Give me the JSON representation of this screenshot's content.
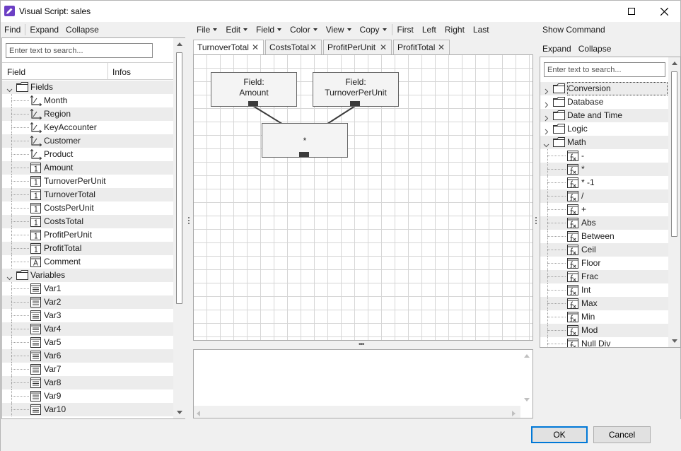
{
  "window": {
    "title": "Visual Script: sales",
    "icon": "pencil-icon"
  },
  "left": {
    "toolbar": [
      "Find",
      "Expand",
      "Collapse"
    ],
    "search_placeholder": "Enter text to search...",
    "columns": [
      "Field",
      "Infos"
    ],
    "tree": [
      {
        "label": "Fields",
        "icon": "folder-icon",
        "expanded": true,
        "level": 0
      },
      {
        "label": "Month",
        "icon": "dimension-icon",
        "level": 1
      },
      {
        "label": "Region",
        "icon": "dimension-icon",
        "level": 1
      },
      {
        "label": "KeyAccounter",
        "icon": "dimension-icon",
        "level": 1
      },
      {
        "label": "Customer",
        "icon": "dimension-icon",
        "level": 1
      },
      {
        "label": "Product",
        "icon": "dimension-icon",
        "level": 1
      },
      {
        "label": "Amount",
        "icon": "number-icon",
        "level": 1
      },
      {
        "label": "TurnoverPerUnit",
        "icon": "number-icon",
        "level": 1
      },
      {
        "label": "TurnoverTotal",
        "icon": "number-icon",
        "level": 1
      },
      {
        "label": "CostsPerUnit",
        "icon": "number-icon",
        "level": 1
      },
      {
        "label": "CostsTotal",
        "icon": "number-icon",
        "level": 1
      },
      {
        "label": "ProfitPerUnit",
        "icon": "number-icon",
        "level": 1
      },
      {
        "label": "ProfitTotal",
        "icon": "number-icon",
        "level": 1
      },
      {
        "label": "Comment",
        "icon": "text-icon",
        "level": 1
      },
      {
        "label": "Variables",
        "icon": "folder-icon",
        "expanded": true,
        "level": 0
      },
      {
        "label": "Var1",
        "icon": "variable-icon",
        "level": 1
      },
      {
        "label": "Var2",
        "icon": "variable-icon",
        "level": 1
      },
      {
        "label": "Var3",
        "icon": "variable-icon",
        "level": 1
      },
      {
        "label": "Var4",
        "icon": "variable-icon",
        "level": 1
      },
      {
        "label": "Var5",
        "icon": "variable-icon",
        "level": 1
      },
      {
        "label": "Var6",
        "icon": "variable-icon",
        "level": 1
      },
      {
        "label": "Var7",
        "icon": "variable-icon",
        "level": 1
      },
      {
        "label": "Var8",
        "icon": "variable-icon",
        "level": 1
      },
      {
        "label": "Var9",
        "icon": "variable-icon",
        "level": 1
      },
      {
        "label": "Var10",
        "icon": "variable-icon",
        "level": 1
      }
    ]
  },
  "center": {
    "menu": [
      {
        "label": "File",
        "dropdown": true
      },
      {
        "label": "Edit",
        "dropdown": true
      },
      {
        "label": "Field",
        "dropdown": true
      },
      {
        "label": "Color",
        "dropdown": true
      },
      {
        "label": "View",
        "dropdown": true
      },
      {
        "label": "Copy",
        "dropdown": true
      },
      {
        "label": "First",
        "dropdown": false
      },
      {
        "label": "Left",
        "dropdown": false
      },
      {
        "label": "Right",
        "dropdown": false
      },
      {
        "label": "Last",
        "dropdown": false
      }
    ],
    "tabs": [
      {
        "label": "TurnoverTotal",
        "active": true
      },
      {
        "label": "CostsTotal",
        "active": false
      },
      {
        "label": "ProfitPerUnit",
        "active": false
      },
      {
        "label": "ProfitTotal",
        "active": false
      }
    ],
    "nodes": {
      "amount": {
        "line1": "Field:",
        "line2": "Amount"
      },
      "turnover_per_unit": {
        "line1": "Field:",
        "line2": "TurnoverPerUnit"
      },
      "multiply": {
        "label": "*"
      }
    },
    "output_text": ""
  },
  "right": {
    "toolbar": [
      "Show Command"
    ],
    "toolbar2": [
      "Expand",
      "Collapse"
    ],
    "search_placeholder": "Enter text to search...",
    "tree": [
      {
        "label": "Conversion",
        "icon": "folder-icon",
        "expanded": false,
        "level": 0,
        "selected": true
      },
      {
        "label": "Database",
        "icon": "folder-icon",
        "expanded": false,
        "level": 0
      },
      {
        "label": "Date and Time",
        "icon": "folder-icon",
        "expanded": false,
        "level": 0
      },
      {
        "label": "Logic",
        "icon": "folder-icon",
        "expanded": false,
        "level": 0
      },
      {
        "label": "Math",
        "icon": "folder-icon",
        "expanded": true,
        "level": 0
      },
      {
        "label": "-",
        "icon": "function-icon",
        "level": 1
      },
      {
        "label": "*",
        "icon": "function-icon",
        "level": 1
      },
      {
        "label": "* -1",
        "icon": "function-icon",
        "level": 1
      },
      {
        "label": "/",
        "icon": "function-icon",
        "level": 1
      },
      {
        "label": "+",
        "icon": "function-icon",
        "level": 1
      },
      {
        "label": "Abs",
        "icon": "function-icon",
        "level": 1
      },
      {
        "label": "Between",
        "icon": "function-icon",
        "level": 1
      },
      {
        "label": "Ceil",
        "icon": "function-icon",
        "level": 1
      },
      {
        "label": "Floor",
        "icon": "function-icon",
        "level": 1
      },
      {
        "label": "Frac",
        "icon": "function-icon",
        "level": 1
      },
      {
        "label": "Int",
        "icon": "function-icon",
        "level": 1
      },
      {
        "label": "Max",
        "icon": "function-icon",
        "level": 1
      },
      {
        "label": "Min",
        "icon": "function-icon",
        "level": 1
      },
      {
        "label": "Mod",
        "icon": "function-icon",
        "level": 1
      },
      {
        "label": "Null Div",
        "icon": "function-icon",
        "level": 1
      }
    ]
  },
  "footer": {
    "ok_label": "OK",
    "cancel_label": "Cancel"
  },
  "colors": {
    "accent": "#0078d7",
    "app_icon": "#6c3fc4",
    "row_alt": "#ececec"
  }
}
